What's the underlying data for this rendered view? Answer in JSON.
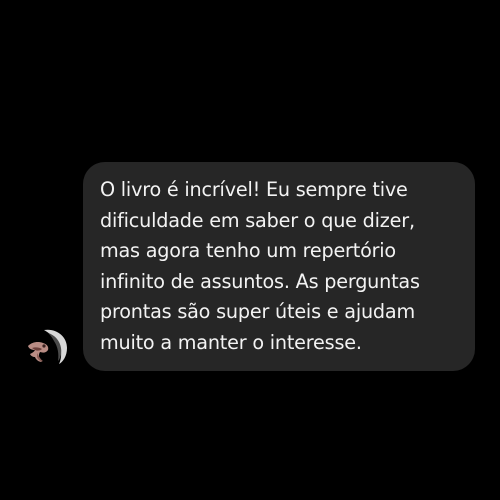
{
  "colors": {
    "background": "#000000",
    "bubble": "#262626",
    "text": "#f3f3f3"
  },
  "message": {
    "avatar_icon": "user-avatar-icon",
    "text": "O livro é incrível! Eu sempre tive\ndificuldade em saber o que dizer,\nmas agora tenho um repertório\ninfinito de assuntos. As perguntas\nprontas são super úteis e ajudam\nmuito a manter o interesse."
  }
}
